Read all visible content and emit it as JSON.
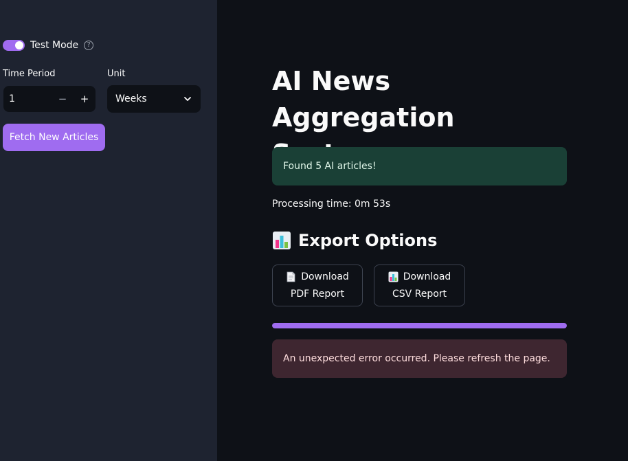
{
  "sidebar": {
    "toggle": {
      "label": "Test Mode",
      "checked": true
    },
    "help_icon": "question-circle-icon",
    "time_period": {
      "label": "Time Period",
      "value": "1",
      "decrement": "−",
      "increment": "+"
    },
    "unit": {
      "label": "Unit",
      "value": "Weeks"
    },
    "fetch_button": "Fetch New Articles"
  },
  "main": {
    "title": "AI News Aggregation System",
    "success_message": "Found 5 AI articles!",
    "processing_time": "Processing time: 0m 53s",
    "export_heading": "Export Options",
    "download_pdf": {
      "line1": "Download",
      "line2": "PDF Report"
    },
    "download_csv": {
      "line1": "Download",
      "line2": "CSV Report"
    },
    "progress": 1.0,
    "error_message": "An unexpected error occurred. Please refresh the page."
  },
  "colors": {
    "accent": "#9f6cf0",
    "background": "#0e1117",
    "sidebar": "#1e2330",
    "success_bg": "#1a4036",
    "error_bg": "#3e2630"
  }
}
